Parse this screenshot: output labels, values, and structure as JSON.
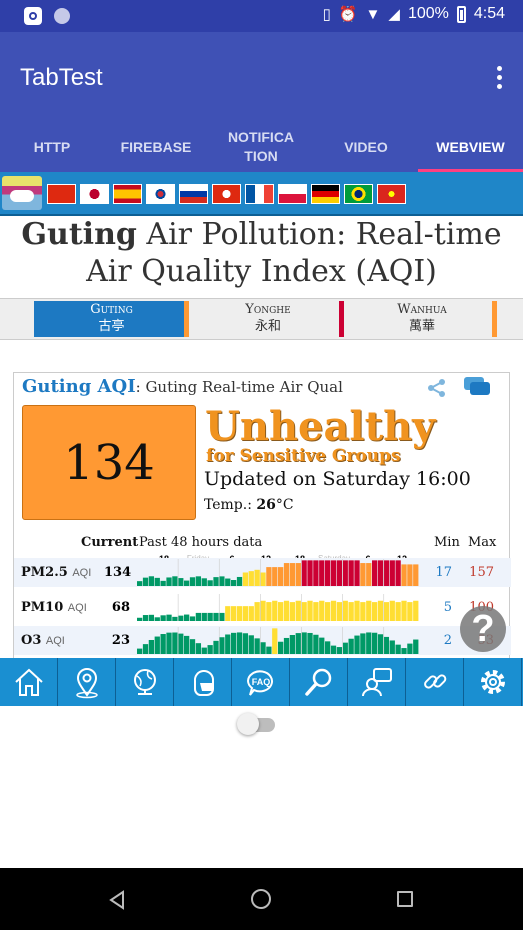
{
  "status_bar": {
    "battery": "100%",
    "time": "4:54"
  },
  "app_bar": {
    "title": "TabTest"
  },
  "tabs": [
    {
      "label": "HTTP",
      "active": false
    },
    {
      "label": "FIREBASE",
      "active": false
    },
    {
      "label": "NOTIFICA\nTION",
      "active": false
    },
    {
      "label": "VIDEO",
      "active": false
    },
    {
      "label": "WEBVIEW",
      "active": true
    }
  ],
  "webview": {
    "flags": [
      "china-flag",
      "japan-flag",
      "spain-flag",
      "korea-flag",
      "russia-flag",
      "hongkong-flag",
      "france-flag",
      "poland-flag",
      "germany-flag",
      "brazil-flag",
      "vietnam-flag"
    ],
    "headline": {
      "city": "Guting",
      "rest": "Air Pollution: Real-time Air Quality Index (AQI)"
    },
    "stations": [
      {
        "name": "Guting",
        "chinese": "古亭",
        "active": true
      },
      {
        "name": "Yonghe",
        "chinese": "永和",
        "active": false
      },
      {
        "name": "Wanhua",
        "chinese": "萬華",
        "active": false
      }
    ],
    "card": {
      "label": "Guting AQI",
      "subtitle": "Guting Real-time Air Qual",
      "aqi": "134",
      "level": "Unhealthy",
      "level_sub": "for Sensitive Groups",
      "updated": "Updated on Saturday 16:00",
      "temp_label": "Temp.:",
      "temp_value": "26",
      "temp_unit": "°C",
      "col_current": "Current",
      "col_history": "Past 48 hours data",
      "col_min": "Min",
      "col_max": "Max",
      "axis_ticks": [
        "18",
        "Friday",
        "6",
        "12",
        "18",
        "Saturday",
        "6",
        "12"
      ],
      "rows": [
        {
          "name": "PM2.5",
          "unit": "AQI",
          "current": "134",
          "min": "17",
          "max": "157"
        },
        {
          "name": "PM10",
          "unit": "AQI",
          "current": "68",
          "min": "5",
          "max": "100"
        },
        {
          "name": "O3",
          "unit": "AQI",
          "current": "23",
          "min": "2",
          "max": "53"
        }
      ]
    },
    "help_label": "?"
  },
  "toolbar_icons": [
    "home-icon",
    "location-pin-icon",
    "globe-icon",
    "mask-icon",
    "faq-icon",
    "search-icon",
    "chat-icon",
    "link-icon",
    "settings-icon"
  ],
  "colors": {
    "status_bar": "#2f3fa8",
    "app_bar": "#3f51b5",
    "tab_indicator": "#ff4081",
    "aqi_orange": "#ff9933",
    "toolbar": "#1a8fd1"
  }
}
